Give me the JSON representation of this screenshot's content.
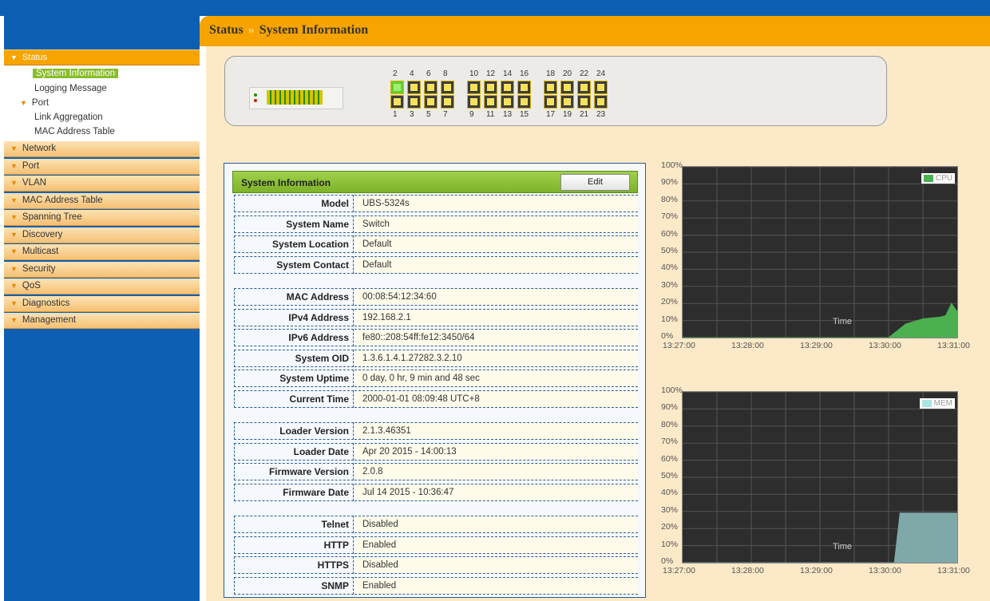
{
  "breadcrumb": {
    "section": "Status",
    "separator": "»",
    "page": "System Information"
  },
  "sidebar": {
    "status": "Status",
    "status_items": [
      {
        "label": "System Information",
        "active": true
      },
      {
        "label": "Logging Message"
      },
      {
        "label": "Port",
        "expandable": true
      },
      {
        "label": "Link Aggregation"
      },
      {
        "label": "MAC Address Table"
      }
    ],
    "menu": [
      "Network",
      "Port",
      "VLAN",
      "MAC Address Table",
      "Spanning Tree",
      "Discovery",
      "Multicast",
      "Security",
      "QoS",
      "Diagnostics",
      "Management"
    ]
  },
  "device": {
    "top_ports": [
      "2",
      "4",
      "6",
      "8",
      "10",
      "12",
      "14",
      "16",
      "18",
      "20",
      "22",
      "24"
    ],
    "bottom_ports": [
      "1",
      "3",
      "5",
      "7",
      "9",
      "11",
      "13",
      "15",
      "17",
      "19",
      "21",
      "23"
    ],
    "link_up_ports": [
      "2"
    ]
  },
  "panel": {
    "title": "System Information",
    "edit_label": "Edit",
    "groups": [
      [
        {
          "label": "Model",
          "value": "UBS-5324s"
        },
        {
          "label": "System Name",
          "value": "Switch"
        },
        {
          "label": "System Location",
          "value": "Default"
        },
        {
          "label": "System Contact",
          "value": "Default"
        }
      ],
      [
        {
          "label": "MAC Address",
          "value": "00:08:54:12:34:60"
        },
        {
          "label": "IPv4 Address",
          "value": "192.168.2.1"
        },
        {
          "label": "IPv6 Address",
          "value": "fe80::208:54ff:fe12:3450/64"
        },
        {
          "label": "System OID",
          "value": "1.3.6.1.4.1.27282.3.2.10"
        },
        {
          "label": "System Uptime",
          "value": "0 day, 0 hr, 9 min and 48 sec"
        },
        {
          "label": "Current Time",
          "value": "2000-01-01 08:09:48 UTC+8"
        }
      ],
      [
        {
          "label": "Loader Version",
          "value": "2.1.3.46351"
        },
        {
          "label": "Loader Date",
          "value": "Apr 20 2015 - 14:00:13"
        },
        {
          "label": "Firmware Version",
          "value": "2.0.8"
        },
        {
          "label": "Firmware Date",
          "value": "Jul 14 2015 - 10:36:47"
        }
      ],
      [
        {
          "label": "Telnet",
          "value": "Disabled"
        },
        {
          "label": "HTTP",
          "value": "Enabled"
        },
        {
          "label": "HTTPS",
          "value": "Disabled"
        },
        {
          "label": "SNMP",
          "value": "Enabled"
        }
      ]
    ]
  },
  "chart_data": [
    {
      "type": "area",
      "series": [
        {
          "name": "CPU",
          "color": "#4caf50",
          "x": [
            "13:27:00",
            "13:30:00",
            "13:30:15",
            "13:30:30",
            "13:30:45",
            "13:30:50",
            "13:30:55",
            "13:31:00"
          ],
          "values": [
            0,
            0,
            8,
            11,
            12,
            13,
            20,
            15
          ]
        }
      ],
      "y_ticks": [
        "0%",
        "10%",
        "20%",
        "30%",
        "40%",
        "50%",
        "60%",
        "70%",
        "80%",
        "90%",
        "100%"
      ],
      "x_ticks": [
        "13:27:00",
        "13:28:00",
        "13:29:00",
        "13:30:00",
        "13:31:00"
      ],
      "xlabel": "Time",
      "ylim": [
        0,
        100
      ],
      "grid": true,
      "legend": "top-right"
    },
    {
      "type": "area",
      "series": [
        {
          "name": "MEM",
          "color": "#7fa8a8",
          "x": [
            "13:27:00",
            "13:30:05",
            "13:30:10",
            "13:31:00"
          ],
          "values": [
            0,
            0,
            29,
            29
          ]
        }
      ],
      "y_ticks": [
        "0%",
        "10%",
        "20%",
        "30%",
        "40%",
        "50%",
        "60%",
        "70%",
        "80%",
        "90%",
        "100%"
      ],
      "x_ticks": [
        "13:27:00",
        "13:28:00",
        "13:29:00",
        "13:30:00",
        "13:31:00"
      ],
      "xlabel": "Time",
      "ylim": [
        0,
        100
      ],
      "grid": true,
      "legend": "top-right"
    }
  ]
}
